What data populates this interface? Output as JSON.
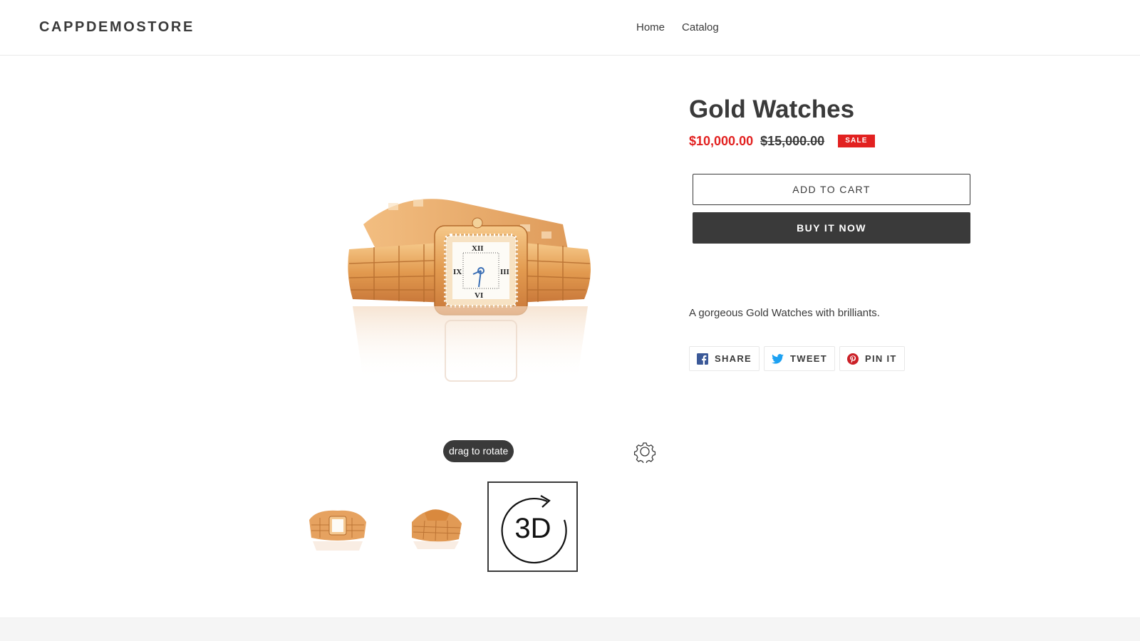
{
  "header": {
    "logo": "CAPPDEMOSTORE",
    "nav": [
      {
        "label": "Home"
      },
      {
        "label": "Catalog"
      }
    ]
  },
  "product": {
    "title": "Gold Watches",
    "sale_price": "$10,000.00",
    "regular_price": "$15,000.00",
    "badge": "SALE",
    "add_to_cart": "ADD TO CART",
    "buy_now": "BUY IT NOW",
    "description": "A gorgeous Gold Watches with brilliants."
  },
  "viewer": {
    "hint": "drag to rotate",
    "settings_icon": "gear-icon",
    "thumbnails": [
      {
        "name": "watch-front-thumbnail",
        "active": false
      },
      {
        "name": "watch-back-thumbnail",
        "active": false
      },
      {
        "name": "3d-view-thumbnail",
        "label": "3D",
        "active": true
      }
    ]
  },
  "social": [
    {
      "label": "SHARE",
      "icon": "facebook-icon",
      "color": "#3b5998"
    },
    {
      "label": "TWEET",
      "icon": "twitter-icon",
      "color": "#1da1f2"
    },
    {
      "label": "PIN IT",
      "icon": "pinterest-icon",
      "color": "#cb2027"
    }
  ],
  "colors": {
    "text": "#3a3a3a",
    "sale": "#e22120",
    "border": "#e8e8e8",
    "footer": "#f5f5f5"
  }
}
